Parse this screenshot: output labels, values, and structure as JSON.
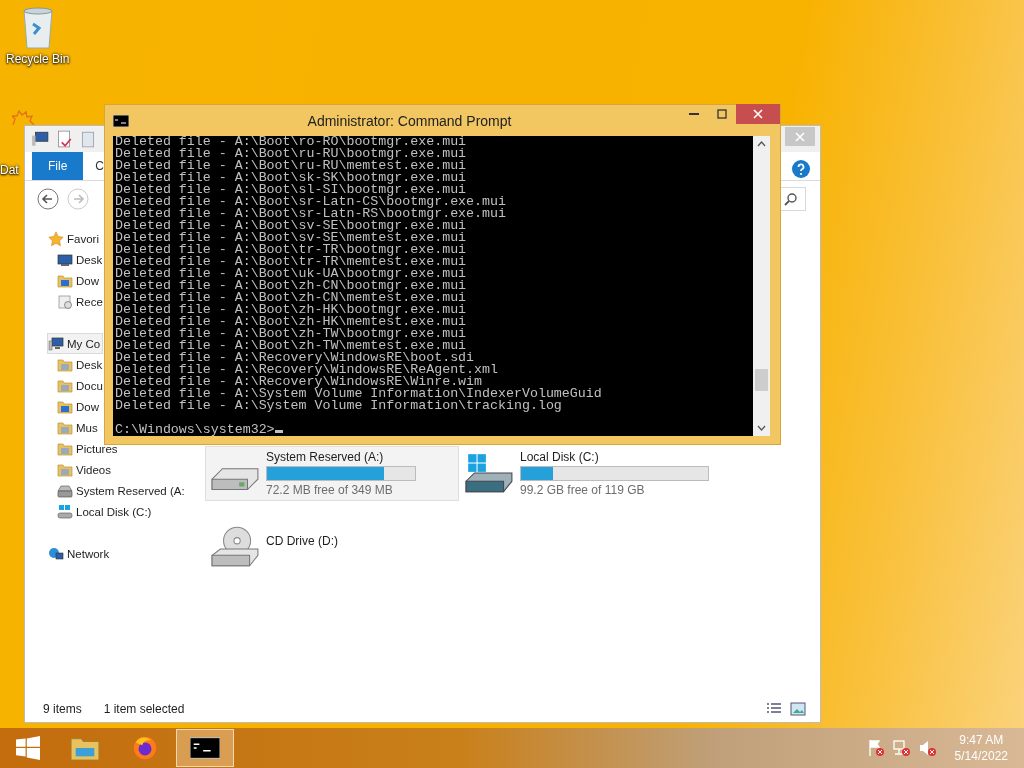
{
  "desktop_icons": [
    {
      "label": "Recycle Bin"
    },
    {
      "label": "Dat"
    }
  ],
  "explorer": {
    "ribbon_tabs": [
      {
        "label": "File",
        "selected": true
      },
      {
        "label": "C",
        "selected": false
      }
    ],
    "sidebar": [
      {
        "label": "Favori",
        "kind": "header",
        "selected": false
      },
      {
        "label": "Desk",
        "kind": "item",
        "selected": false
      },
      {
        "label": "Dow",
        "kind": "item",
        "selected": false
      },
      {
        "label": "Rece",
        "kind": "item",
        "selected": false
      },
      {
        "label": "My Co",
        "kind": "header",
        "selected": true
      },
      {
        "label": "Desk",
        "kind": "item",
        "selected": false
      },
      {
        "label": "Docu",
        "kind": "item",
        "selected": false
      },
      {
        "label": "Dow",
        "kind": "item",
        "selected": false
      },
      {
        "label": "Mus",
        "kind": "item",
        "selected": false
      },
      {
        "label": "Pictures",
        "kind": "item",
        "selected": false
      },
      {
        "label": "Videos",
        "kind": "item",
        "selected": false
      },
      {
        "label": "System Reserved (A:",
        "kind": "item",
        "selected": false
      },
      {
        "label": "Local Disk (C:)",
        "kind": "item",
        "selected": false
      },
      {
        "label": "Network",
        "kind": "header",
        "selected": false
      }
    ],
    "drives": [
      {
        "name": "System Reserved (A:)",
        "kind": "disk",
        "level": 0.79,
        "free": "72.2 MB free of 349 MB",
        "selected": true
      },
      {
        "name": "Local Disk (C:)",
        "kind": "windows-disk",
        "level": 0.17,
        "free": "99.2 GB free of 119 GB",
        "selected": false
      },
      {
        "name": "CD Drive (D:)",
        "kind": "cd",
        "selected": false
      }
    ],
    "status_bar": {
      "items": "9 items",
      "selection": "1 item selected"
    }
  },
  "console": {
    "title": "Administrator: Command Prompt",
    "lines": [
      "Deleted file - A:\\Boot\\ro-RO\\bootmgr.exe.mui",
      "Deleted file - A:\\Boot\\ru-RU\\bootmgr.exe.mui",
      "Deleted file - A:\\Boot\\ru-RU\\memtest.exe.mui",
      "Deleted file - A:\\Boot\\sk-SK\\bootmgr.exe.mui",
      "Deleted file - A:\\Boot\\sl-SI\\bootmgr.exe.mui",
      "Deleted file - A:\\Boot\\sr-Latn-CS\\bootmgr.exe.mui",
      "Deleted file - A:\\Boot\\sr-Latn-RS\\bootmgr.exe.mui",
      "Deleted file - A:\\Boot\\sv-SE\\bootmgr.exe.mui",
      "Deleted file - A:\\Boot\\sv-SE\\memtest.exe.mui",
      "Deleted file - A:\\Boot\\tr-TR\\bootmgr.exe.mui",
      "Deleted file - A:\\Boot\\tr-TR\\memtest.exe.mui",
      "Deleted file - A:\\Boot\\uk-UA\\bootmgr.exe.mui",
      "Deleted file - A:\\Boot\\zh-CN\\bootmgr.exe.mui",
      "Deleted file - A:\\Boot\\zh-CN\\memtest.exe.mui",
      "Deleted file - A:\\Boot\\zh-HK\\bootmgr.exe.mui",
      "Deleted file - A:\\Boot\\zh-HK\\memtest.exe.mui",
      "Deleted file - A:\\Boot\\zh-TW\\bootmgr.exe.mui",
      "Deleted file - A:\\Boot\\zh-TW\\memtest.exe.mui",
      "Deleted file - A:\\Recovery\\WindowsRE\\boot.sdi",
      "Deleted file - A:\\Recovery\\WindowsRE\\ReAgent.xml",
      "Deleted file - A:\\Recovery\\WindowsRE\\Winre.wim",
      "Deleted file - A:\\System Volume Information\\IndexerVolumeGuid",
      "Deleted file - A:\\System Volume Information\\tracking.log"
    ],
    "prompt": "C:\\Windows\\system32>"
  },
  "taskbar": {
    "apps": [
      {
        "kind": "explorer",
        "selected": false
      },
      {
        "kind": "firefox",
        "selected": false
      },
      {
        "kind": "console",
        "selected": true
      }
    ],
    "time": "9:47 AM",
    "date": "5/14/2022"
  }
}
